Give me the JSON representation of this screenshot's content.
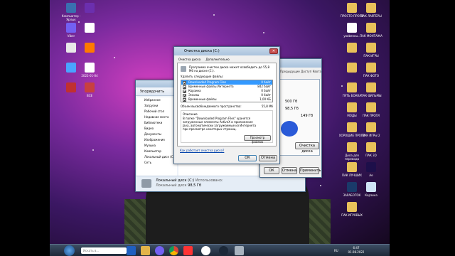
{
  "desktop_left": [
    {
      "label": "Компьютер - Ярлык",
      "color": "#3a6fb0"
    },
    {
      "label": "Viber",
      "color": "#7360f2"
    },
    {
      "label": "",
      "color": "#e8e8e8"
    },
    {
      "label": "",
      "color": "#4aa3ff"
    },
    {
      "label": "",
      "color": "#c03030"
    },
    {
      "label": "",
      "color": "#6b2fae"
    },
    {
      "label": "",
      "color": "#ffffff"
    },
    {
      "label": "",
      "color": "#ff7a00"
    },
    {
      "label": "2022-01-04",
      "color": "#ffffff"
    },
    {
      "label": "ВСЕ",
      "color": "#c84040"
    }
  ],
  "desktop_right": [
    {
      "label": "ПРОСТО ПРОГИ",
      "color": "#e8c15a"
    },
    {
      "label": "yoobenou...",
      "color": "#ffffff"
    },
    {
      "label": "",
      "color": "#e8c15a"
    },
    {
      "label": "",
      "color": "#e8c15a"
    },
    {
      "label": "ПУТЬ БОККА",
      "color": "#e8c15a"
    },
    {
      "label": "МОДЫ",
      "color": "#e8c15a"
    },
    {
      "label": "ХОРОШИЕ ПРОГИ",
      "color": "#e8c15a"
    },
    {
      "label": "Дела для перевода",
      "color": "#e8c15a"
    },
    {
      "label": "ПАК ЛУЧШИХ",
      "color": "#e8c15a"
    },
    {
      "label": "ЗАРАБОТОК",
      "color": "#1a3a6a"
    },
    {
      "label": "ПАК ИГРОВЫХ",
      "color": "#e8c15a"
    },
    {
      "label": "ПАК ЛАЙТЕРЫ",
      "color": "#e8c15a"
    },
    {
      "label": "ПАК МОНТАЖА",
      "color": "#e8c15a"
    },
    {
      "label": "ПАК ИГРЫ",
      "color": "#e8c15a"
    },
    {
      "label": "ПАК ФОТО",
      "color": "#e8c15a"
    },
    {
      "label": "ПАК ФИЛЬМЫ",
      "color": "#e8c15a"
    },
    {
      "label": "ПАК ПРОГИ",
      "color": "#e8c15a"
    },
    {
      "label": "ПАК ИГРЫ 2",
      "color": "#e8c15a"
    },
    {
      "label": "ПАК 3D",
      "color": "#e8c15a"
    },
    {
      "label": "Ae",
      "color": "#1d0f4a"
    },
    {
      "label": "Корзина",
      "color": "#cfe4f5"
    }
  ],
  "disk_cleanup": {
    "title": "Очистка диска (C:)",
    "tabs": [
      "Очистка диска",
      "Дополнительно"
    ],
    "intro": "Программа очистки диска может освободить до 55,8 Мб на диске (C:).",
    "files_label": "Удалить следующие файлы:",
    "items": [
      {
        "name": "Downloaded Program Files",
        "size": "0 байт",
        "checked": true,
        "selected": true
      },
      {
        "name": "Временные файлы Интернета",
        "size": "842 байт",
        "checked": true,
        "selected": false
      },
      {
        "name": "Корзина",
        "size": "0 байт",
        "checked": true,
        "selected": false
      },
      {
        "name": "Эскизы",
        "size": "0 байт",
        "checked": true,
        "selected": false
      },
      {
        "name": "Временные файлы",
        "size": "1,00 КБ",
        "checked": true,
        "selected": false
      }
    ],
    "total_label": "Объем высвобождаемого пространства:",
    "total_value": "55,8 Мб",
    "desc_label": "Описание",
    "description": "В папке \"Downloaded Program Files\" хранятся загруженные элементы ActiveX и приложения Java, автоматически загружаемые из Интернета при просмотре некоторых страниц.",
    "view_files_button": "Просмотр файлов",
    "how_link": "Как работает очистка диска?",
    "ok_button": "ОК",
    "cancel_button": "Отмена"
  },
  "properties_window": {
    "values": [
      "500 Гб",
      "98,5 Гб",
      "149 Гб"
    ],
    "cleanup_button": "Очистка диска",
    "tabs": [
      "Предыдущие",
      "Доступ",
      "Квота"
    ],
    "ok_button": "ОК",
    "cancel_button": "Отмена",
    "apply_button": "Применить"
  },
  "explorer": {
    "toolbar": "Упорядочить",
    "nav": [
      "Избранное",
      "Загрузки",
      "Рабочий стол",
      "Недавние места",
      "Библиотеки",
      "Видео",
      "Документы",
      "Изображения",
      "Музыка",
      "Компьютер",
      "Локальный диск (C:)",
      "Сеть"
    ],
    "status_name": "Локальный диск (C:)",
    "status_label": "Локальный диск",
    "status_used": "Использовано:",
    "status_free": "98,5 Гб"
  },
  "taskbar": {
    "search_placeholder": "Искать в...",
    "time": "6:47",
    "date": "01.08.2022",
    "lang": "RU"
  }
}
